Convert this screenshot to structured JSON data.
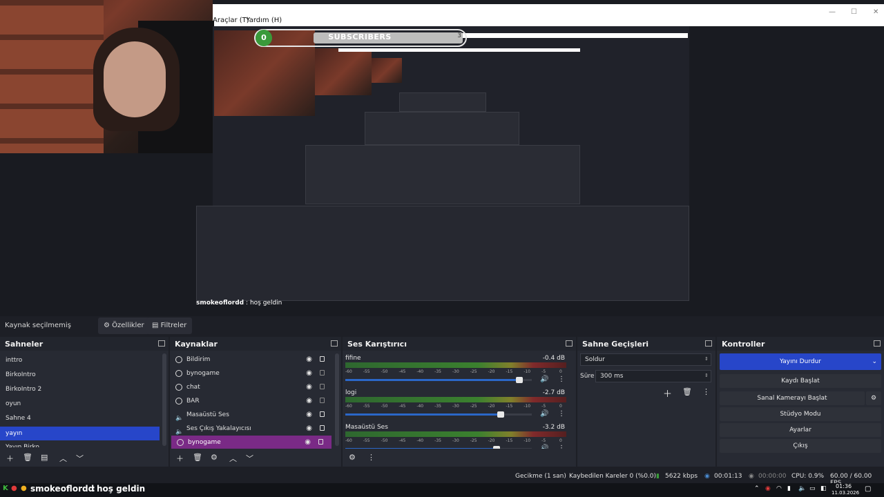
{
  "menu": {
    "items": [
      "Araçlar (T)",
      "Yardım (H)"
    ]
  },
  "overlay": {
    "subscribers_label": "SUBSCRIBERS",
    "subscribers_count": "0",
    "subscribers_goal": "3",
    "progress": 0
  },
  "preview_chat": {
    "user": "smokeoflordd",
    "sep": ":",
    "message": "hoş geldin"
  },
  "source_toolbar": {
    "status": "Kaynak seçilmemiş",
    "properties_label": "Özellikler",
    "filters_label": "Filtreler"
  },
  "scenes": {
    "title": "Sahneler",
    "items": [
      {
        "label": "inttro"
      },
      {
        "label": "BirkoIntro"
      },
      {
        "label": "BirkoIntro 2"
      },
      {
        "label": "oyun"
      },
      {
        "label": "Sahne 4"
      },
      {
        "label": "yayın"
      },
      {
        "label": "Yayın Birko"
      }
    ],
    "selected": "yayın"
  },
  "sources": {
    "title": "Kaynaklar",
    "items": [
      {
        "label": "Bildirim"
      },
      {
        "label": "bynogame"
      },
      {
        "label": "chat"
      },
      {
        "label": "BAR"
      },
      {
        "label": "Masaüstü Ses"
      },
      {
        "label": "Ses Çıkış Yakalayıcısı"
      },
      {
        "label": "bynogame"
      }
    ],
    "selected": "bynogame"
  },
  "mixer": {
    "title": "Ses Karıştırıcı",
    "ticks": [
      "-60",
      "-55",
      "-50",
      "-45",
      "-40",
      "-35",
      "-30",
      "-25",
      "-20",
      "-15",
      "-10",
      "-5",
      "0"
    ],
    "channels": [
      {
        "name": "fifine",
        "db": "-0.4 dB",
        "volume": 0.95
      },
      {
        "name": "logi",
        "db": "-2.7 dB",
        "volume": 0.85
      },
      {
        "name": "Masaüstü Ses",
        "db": "-3.2 dB",
        "volume": 0.83
      }
    ]
  },
  "transitions": {
    "title": "Sahne Geçişleri",
    "selected": "Soldur",
    "duration_label": "Süre",
    "duration_value": "300 ms"
  },
  "controls": {
    "title": "Kontroller",
    "stream": "Yayını Durdur",
    "record": "Kaydı Başlat",
    "virtual_cam": "Sanal Kamerayı Başlat",
    "studio": "Stüdyo Modu",
    "settings": "Ayarlar",
    "exit": "Çıkış"
  },
  "status": {
    "delay": "Gecikme (1 san)",
    "dropped": "Kaybedilen Kareler 0 (%0.0)",
    "bitrate": "5622 kbps",
    "stream_time": "00:01:13",
    "rec_time": "00:00:00",
    "cpu": "CPU: 0.9%",
    "fps": "60.00 / 60.00 FPS"
  },
  "taskbar": {
    "chat_user": "smokeoflordd",
    "chat_sep": ":",
    "chat_msg": "hoş geldin",
    "time": "01:36",
    "date": "11.03.2026"
  },
  "colors": {
    "accent_blue": "#2746c9",
    "accent_purple": "#7a2a86",
    "bg": "#1d1f26",
    "panel": "#272a33"
  }
}
